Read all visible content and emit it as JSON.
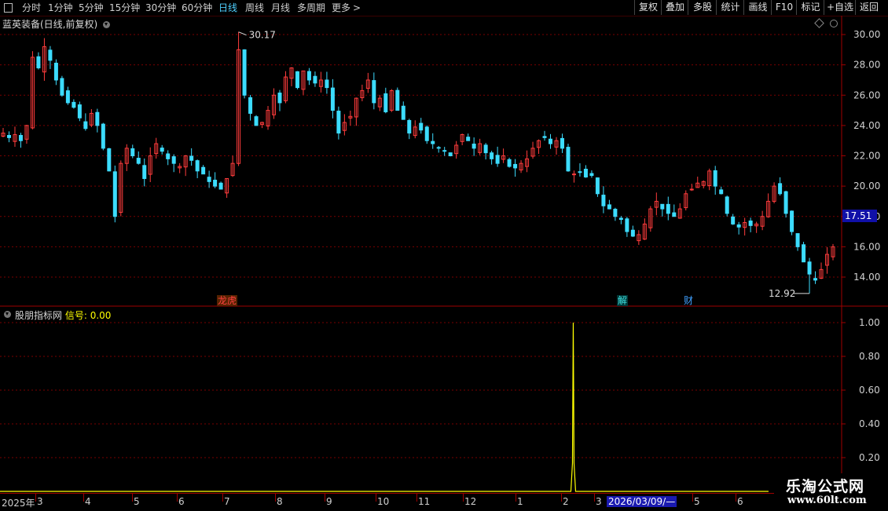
{
  "toolbar": {
    "periods": [
      {
        "label": "分时",
        "active": false
      },
      {
        "label": "1分钟",
        "active": false
      },
      {
        "label": "5分钟",
        "active": false
      },
      {
        "label": "15分钟",
        "active": false
      },
      {
        "label": "30分钟",
        "active": false
      },
      {
        "label": "60分钟",
        "active": false
      },
      {
        "label": "日线",
        "active": true
      },
      {
        "label": "周线",
        "active": false
      },
      {
        "label": "月线",
        "active": false
      },
      {
        "label": "多周期",
        "active": false
      },
      {
        "label": "更多",
        "active": false
      }
    ],
    "more_arrow": ">",
    "right_buttons": [
      "复权",
      "叠加",
      "多股",
      "统计",
      "画线",
      "F10",
      "标记",
      "+自选",
      "返回"
    ]
  },
  "main_chart": {
    "title": "蓝英装备(日线,前复权)",
    "current_price": "17.51",
    "high_label": "30.17",
    "low_label": "12.92",
    "events": [
      {
        "text": "龙虎",
        "color": "#ff4040"
      },
      {
        "text": "解",
        "color": "#40e0e0"
      },
      {
        "text": "财",
        "color": "#40a0ff"
      }
    ]
  },
  "indicator": {
    "name": "股朋指标网",
    "signal_label": "信号:",
    "signal_value": "0.00"
  },
  "x_axis": {
    "year_label": "2025年",
    "months": [
      "3",
      "4",
      "5",
      "6",
      "7",
      "8",
      "9",
      "10",
      "11",
      "12",
      "1",
      "2",
      "3",
      "5",
      "6"
    ],
    "cursor_date": "2026/03/09/—"
  },
  "watermark": {
    "name": "乐淘公式网",
    "url": "www.60lt.com"
  },
  "colors": {
    "up": "#ff3c3c",
    "down": "#3cdcff",
    "signal": "#ffff00",
    "grid": "#7a0000",
    "axis": "#a00000"
  },
  "chart_data": [
    {
      "type": "candlestick",
      "title": "蓝英装备(日线,前复权)",
      "ylim": [
        12.5,
        30.5
      ],
      "yticks": [
        14.0,
        16.0,
        18.0,
        20.0,
        22.0,
        24.0,
        26.0,
        28.0,
        30.0
      ],
      "close_trajectory": [
        23.5,
        23.2,
        23.4,
        23.0,
        24.0,
        28.5,
        27.8,
        29.2,
        28.3,
        27.0,
        26.0,
        25.5,
        25.2,
        24.5,
        23.8,
        24.8,
        24.0,
        22.5,
        21.0,
        18.0,
        21.5,
        22.5,
        22.0,
        21.5,
        20.5,
        22.0,
        22.8,
        22.3,
        21.8,
        21.5,
        21.3,
        22.0,
        21.7,
        21.0,
        20.8,
        20.3,
        20.0,
        19.8,
        20.5,
        21.5,
        29.0,
        26.0,
        24.8,
        24.0,
        24.2,
        25.0,
        26.0,
        25.5,
        27.2,
        27.8,
        26.5,
        27.6,
        27.0,
        26.8,
        27.0,
        26.5,
        25.0,
        23.5,
        24.2,
        24.6,
        25.8,
        26.3,
        27.0,
        25.5,
        25.8,
        24.9,
        26.3,
        25.0,
        24.4,
        23.5,
        23.9,
        23.7,
        23.0,
        22.8,
        22.5,
        22.3,
        22.0,
        22.7,
        23.4,
        23.0,
        22.5,
        22.8,
        22.2,
        21.8,
        21.5,
        22.0,
        21.3,
        21.2,
        21.5,
        21.8,
        22.5,
        23.0,
        23.2,
        22.8,
        23.0,
        22.5,
        21.0,
        20.8,
        20.9,
        20.6,
        20.7,
        19.5,
        18.7,
        18.5,
        18.0,
        17.8,
        17.0,
        16.7,
        16.8,
        17.5,
        18.5,
        19.0,
        18.5,
        18.2,
        18.0,
        18.5,
        19.5,
        19.8,
        20.2,
        20.3,
        21.0,
        20.0,
        19.5,
        18.2,
        17.5,
        17.3,
        17.6,
        17.4,
        17.5,
        18.0,
        19.0,
        20.0,
        19.5,
        18.2,
        17.0,
        16.0,
        15.0,
        14.2,
        13.8,
        14.5,
        15.5,
        16.0
      ],
      "high": 30.17,
      "low": 12.92,
      "last_price": 17.51
    },
    {
      "type": "line",
      "title": "股朋指标网",
      "series": [
        {
          "name": "信号",
          "spike_index_fraction": 0.687,
          "spike_value": 1.0,
          "baseline": 0.0
        }
      ],
      "ylim": [
        0.0,
        1.0
      ],
      "yticks": [
        0.2,
        0.4,
        0.6,
        0.8,
        1.0
      ]
    }
  ]
}
